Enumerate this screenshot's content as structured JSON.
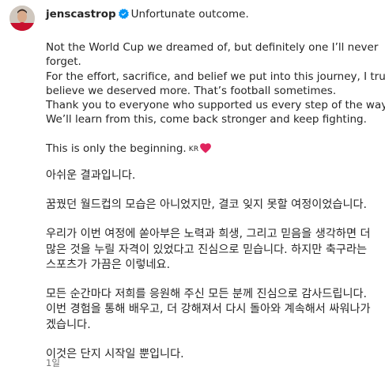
{
  "post": {
    "username": "jenscastrop",
    "verified_icon": "verified-badge-icon",
    "caption_head": "Unfortunate outcome.",
    "english_paragraph_1": [
      "Not the World Cup we dreamed of, but definitely one I’ll never",
      "forget.",
      "For the effort, sacrifice, and belief we put into this journey, I truly",
      "believe we deserved more. That’s football sometimes.",
      "Thank you to everyone who supported us every step of the way.",
      "We’ll learn from this, come back stronger and keep fighting."
    ],
    "english_paragraph_2": "This is only the beginning.",
    "flag_code": "KR",
    "heart_icon": "red-heart-icon",
    "korean_paragraph_1": "아쉬운 결과입니다.",
    "korean_paragraph_2": "꿈꿨던 월드컵의 모습은 아니었지만, 결코 잊지 못할 여정이었습니다.",
    "korean_paragraph_3": [
      "우리가 이번 여정에 쏟아부은 노력과 희생, 그리고 믿음을 생각하면 더",
      "많은 것을 누릴 자격이 있었다고 진심으로 믿습니다. 하지만 축구라는",
      "스포츠가 가끔은 이렇네요."
    ],
    "korean_paragraph_4": [
      "모든 순간마다 저희를 응원해 주신 모든 분께 진심으로 감사드립니다.",
      "이번 경험을 통해 배우고, 더 강해져서 다시 돌아와 계속해서 싸워나가",
      "겠습니다."
    ],
    "korean_paragraph_5": "이것은 단지 시작일 뿐입니다.",
    "timestamp": "1일"
  },
  "colors": {
    "text": "#262626",
    "muted": "#737373",
    "verified_blue": "#0095f6",
    "heart_red": "#e0245e",
    "background": "#ffffff"
  }
}
